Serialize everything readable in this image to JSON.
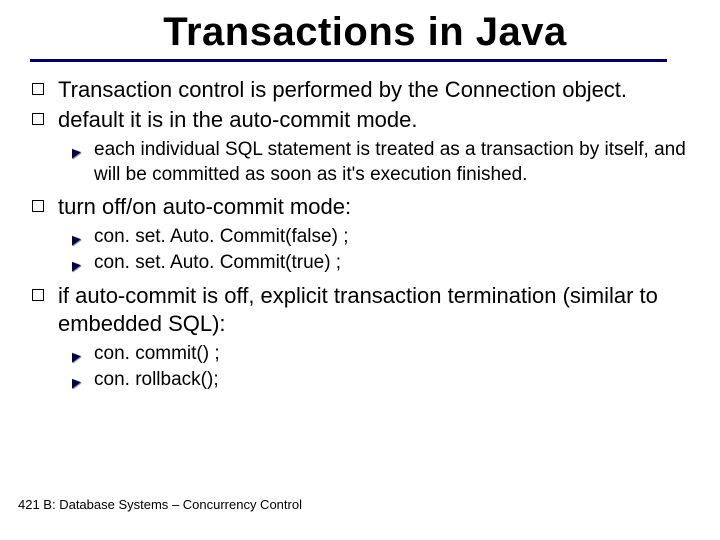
{
  "title": "Transactions in Java",
  "bullets": [
    {
      "text": "Transaction control is performed by the Connection object.",
      "sub": []
    },
    {
      "text": "default it is in the auto-commit mode.",
      "sub": [
        "each individual SQL statement is treated as a transaction by itself, and will be committed as soon as it's execution finished."
      ]
    },
    {
      "text": "turn off/on auto-commit mode:",
      "sub": [
        "con. set. Auto. Commit(false) ;",
        "con. set. Auto. Commit(true) ;"
      ]
    },
    {
      "text": "if auto-commit is off, explicit transaction termination (similar to embedded SQL):",
      "sub": [
        "con. commit() ;",
        "con. rollback();"
      ]
    }
  ],
  "footer": "421 B: Database Systems – Concurrency Control"
}
